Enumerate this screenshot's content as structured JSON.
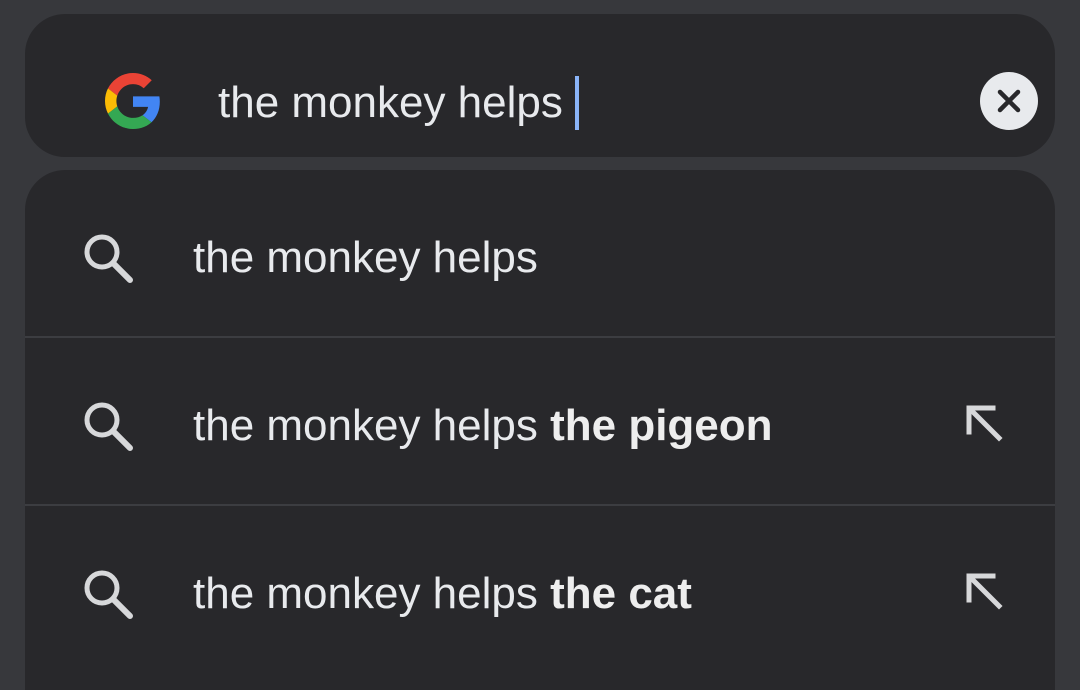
{
  "search": {
    "query": "the monkey helps",
    "logo_icon": "google-g-icon",
    "clear_icon": "close-icon"
  },
  "suggestions": [
    {
      "prefix": "the monkey helps",
      "completion": "",
      "icon": "search-icon",
      "has_fill": false
    },
    {
      "prefix": "the monkey helps ",
      "completion": "the pigeon",
      "icon": "search-icon",
      "has_fill": true
    },
    {
      "prefix": "the monkey helps ",
      "completion": "the cat",
      "icon": "search-icon",
      "has_fill": true
    }
  ],
  "colors": {
    "background": "#37383c",
    "surface": "#28282b",
    "text": "#e8eaed",
    "caret": "#8ab4f8",
    "icon": "#d7d8da"
  }
}
